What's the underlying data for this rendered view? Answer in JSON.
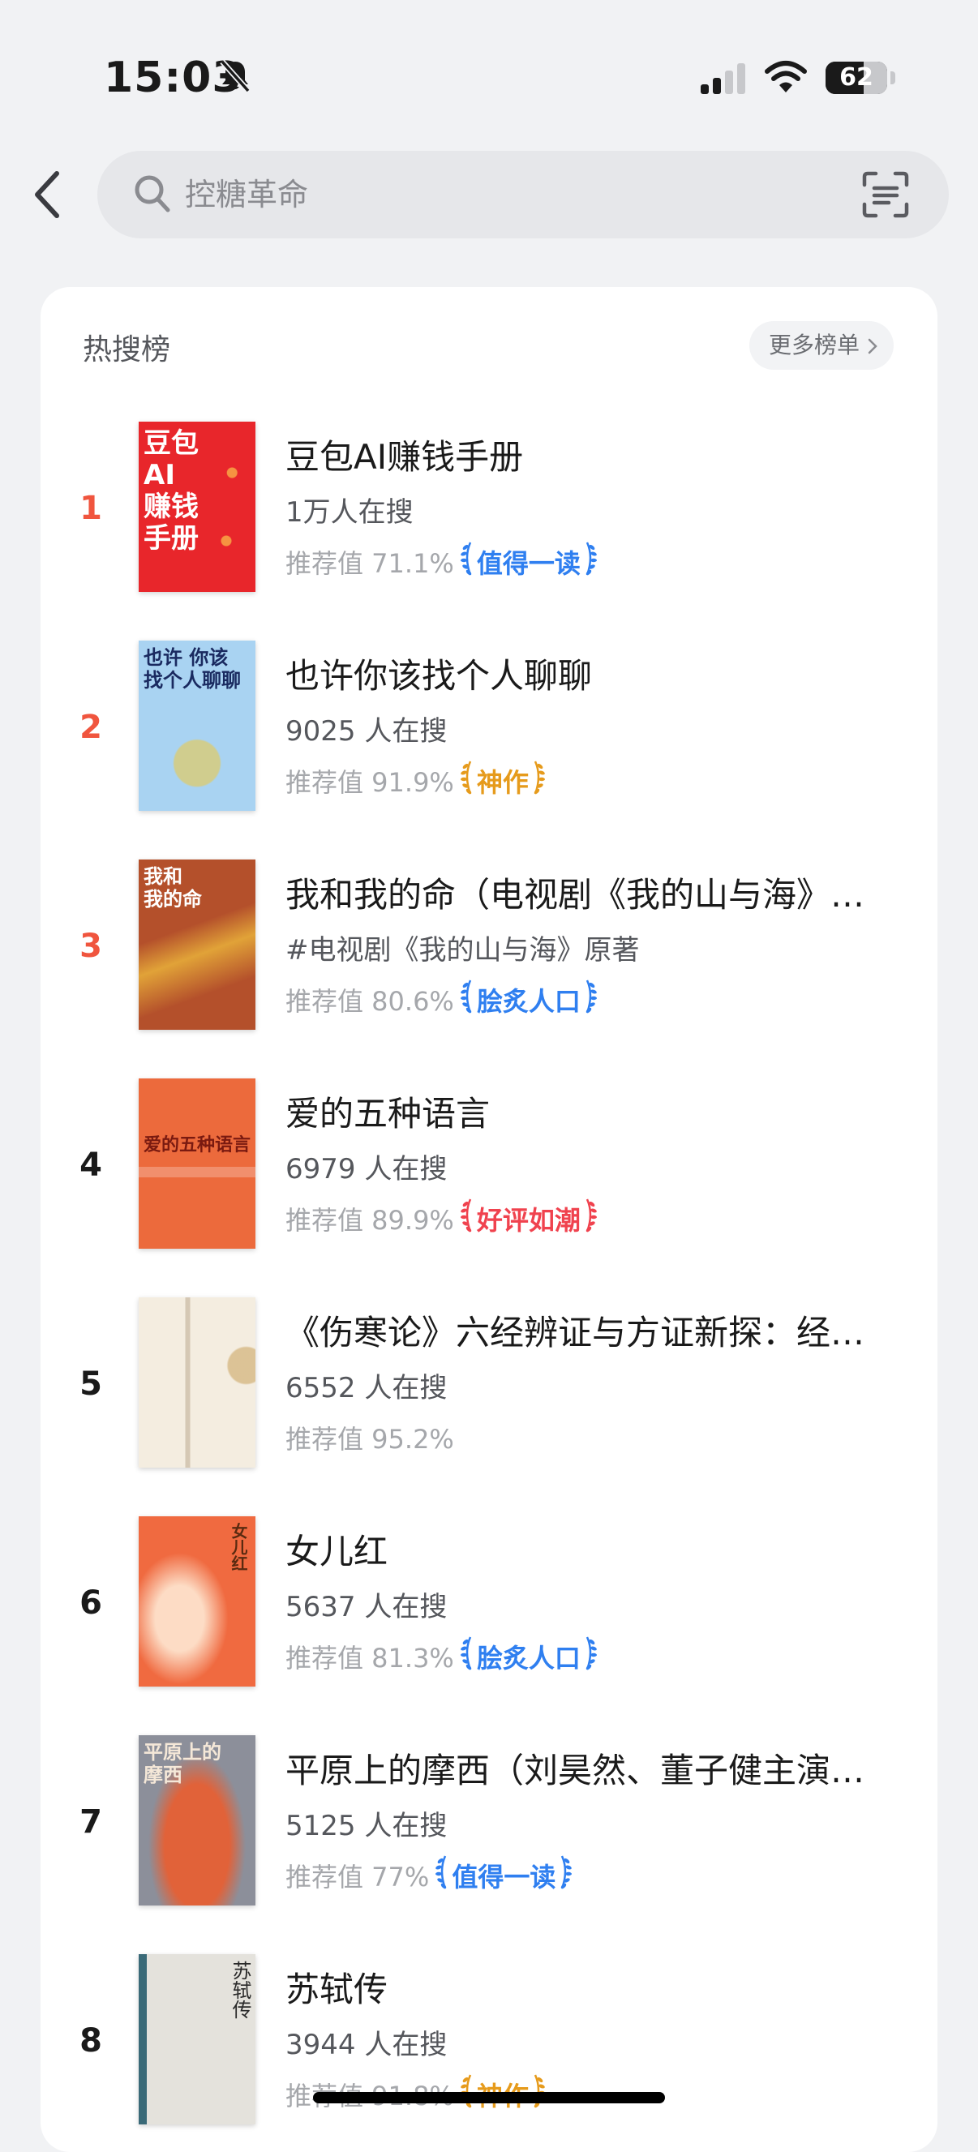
{
  "status_bar": {
    "time": "15:03",
    "battery": "62",
    "battery_level": 0.62
  },
  "search": {
    "placeholder": "控糖革命"
  },
  "hot_list": {
    "title": "热搜榜",
    "more_label": "更多榜单",
    "items": [
      {
        "rank": "1",
        "rank_color": "#f0553e",
        "title": "豆包AI赚钱手册",
        "sub": "1万人在搜",
        "score": "推荐值 71.1%",
        "badge": "值得一读",
        "badge_color": "#2f7ff0",
        "cover": {
          "bg": "#e8262b",
          "text": "豆包\nAI\n赚钱\n手册",
          "text_color": "#ffffff"
        }
      },
      {
        "rank": "2",
        "rank_color": "#f0553e",
        "title": "也许你该找个人聊聊",
        "sub": "9025 人在搜",
        "score": "推荐值 91.9%",
        "badge": "神作",
        "badge_color": "#e69b1c",
        "cover": {
          "bg": "#a9d3f2",
          "text": "也许 你该\n找个人聊聊",
          "text_color": "#1a2a60"
        }
      },
      {
        "rank": "3",
        "rank_color": "#f0553e",
        "title": "我和我的命（电视剧《我的山与海》…",
        "sub": "#电视剧《我的山与海》原著",
        "score": "推荐值 80.6%",
        "badge": "脍炙人口",
        "badge_color": "#2f7ff0",
        "cover": {
          "bg": "#b4502b",
          "text": "我和\n我的命",
          "text_color": "#ffffff"
        }
      },
      {
        "rank": "4",
        "rank_color": "#1a1a1a",
        "title": "爱的五种语言",
        "sub": "6979 人在搜",
        "score": "推荐值 89.9%",
        "badge": "好评如潮",
        "badge_color": "#f0424e",
        "cover": {
          "bg": "#ec6a3c",
          "text": "爱的五种语言",
          "text_color": "#7a1a10"
        }
      },
      {
        "rank": "5",
        "rank_color": "#1a1a1a",
        "title": "《伤寒论》六经辨证与方证新探：经…",
        "sub": "6552 人在搜",
        "score": "推荐值 95.2%",
        "badge": "",
        "badge_color": "",
        "cover": {
          "bg": "#f4ede0",
          "text": "",
          "text_color": "#7a5a30"
        }
      },
      {
        "rank": "6",
        "rank_color": "#1a1a1a",
        "title": "女儿红",
        "sub": "5637 人在搜",
        "score": "推荐值 81.3%",
        "badge": "脍炙人口",
        "badge_color": "#2f7ff0",
        "cover": {
          "bg": "#f06a40",
          "text": "女儿红",
          "text_color": "#5a2a10"
        }
      },
      {
        "rank": "7",
        "rank_color": "#1a1a1a",
        "title": "平原上的摩西（刘昊然、董子健主演…",
        "sub": "5125 人在搜",
        "score": "推荐值 77%",
        "badge": "值得一读",
        "badge_color": "#2f7ff0",
        "cover": {
          "bg": "#8c8f9a",
          "text": "平原上的\n摩西",
          "text_color": "#f5e8d8"
        }
      },
      {
        "rank": "8",
        "rank_color": "#1a1a1a",
        "title": "苏轼传",
        "sub": "3944 人在搜",
        "score": "推荐值 91.8%",
        "badge": "神作",
        "badge_color": "#e69b1c",
        "cover": {
          "bg": "#e4e2dc",
          "text": "苏轼传",
          "text_color": "#2a2a2a"
        }
      }
    ]
  }
}
